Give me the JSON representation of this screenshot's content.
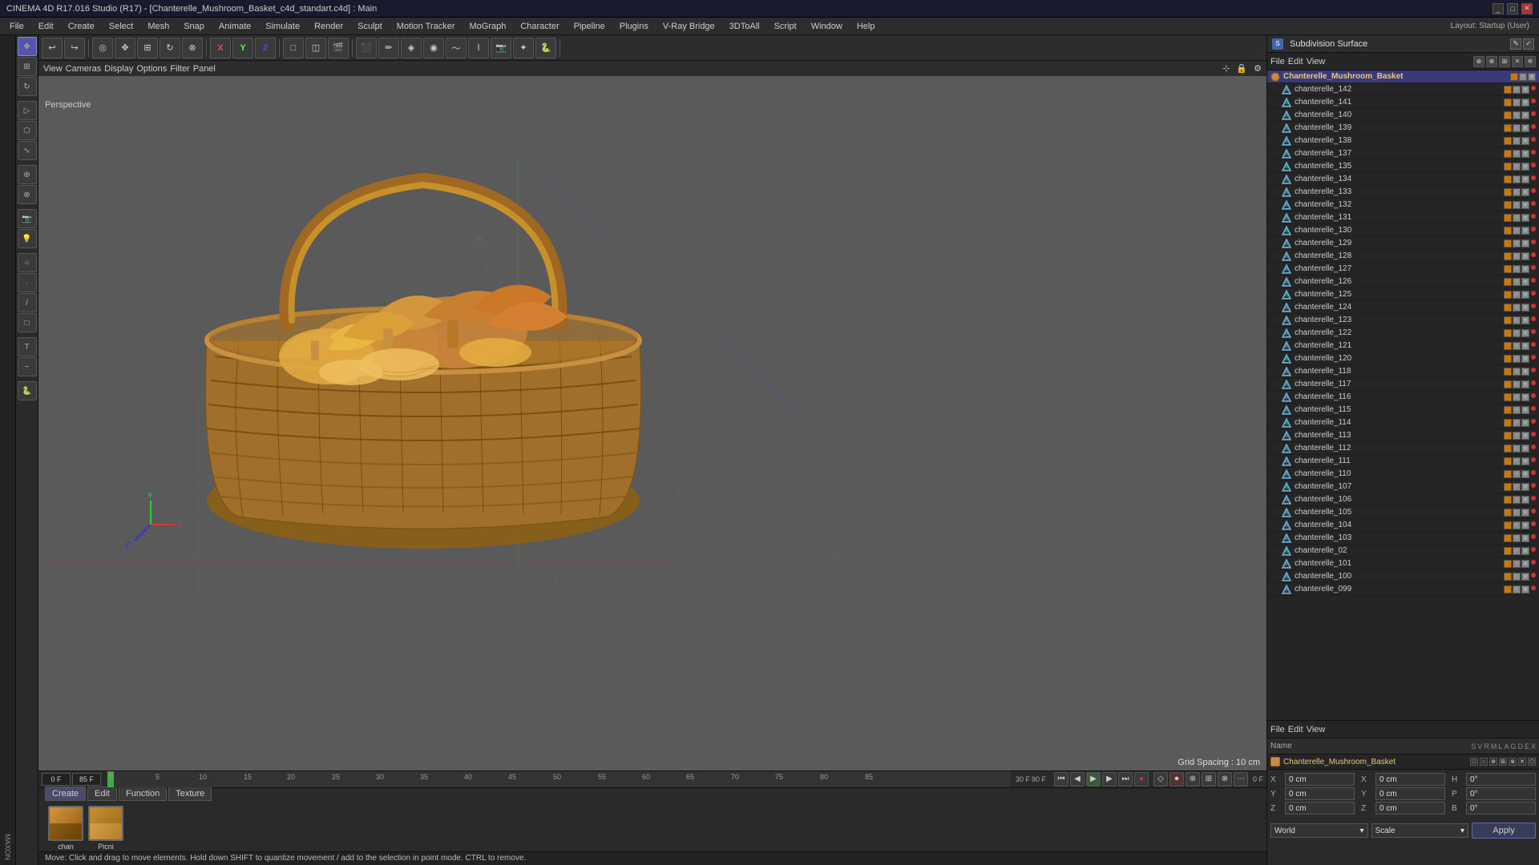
{
  "titleBar": {
    "title": "CINEMA 4D R17.016 Studio (R17) - [Chanterelle_Mushroom_Basket_c4d_standart.c4d] : Main",
    "winControls": [
      "_",
      "□",
      "✕"
    ]
  },
  "menuBar": {
    "items": [
      "File",
      "Edit",
      "Create",
      "Select",
      "Mesh",
      "Snap",
      "Animate",
      "Simulate",
      "Render",
      "Sculpt",
      "Motion Tracker",
      "MoGraph",
      "Character",
      "Pipeline",
      "Plugins",
      "V-Ray Bridge",
      "3DToAll",
      "Script",
      "Window",
      "Help"
    ]
  },
  "topToolbar": {
    "undoLabel": "↩",
    "layoutLabel": "Layout: Startup (User)"
  },
  "viewport": {
    "tabs": [
      "View",
      "Cameras",
      "Display",
      "Options",
      "Filter",
      "Panel"
    ],
    "mode": "Perspective",
    "gridSpacing": "Grid Spacing : 10 cm"
  },
  "timeline": {
    "startFrame": "0 F",
    "endFrame": "90 F",
    "currentFrame": "0 F",
    "fps": "30 F",
    "frameMarkers": [
      0,
      5,
      10,
      15,
      20,
      25,
      30,
      35,
      40,
      45,
      50,
      55,
      60,
      65,
      70,
      75,
      80,
      85
    ],
    "frameEnd": "85 F",
    "playControls": [
      "⏮",
      "⏪",
      "▶",
      "⏩",
      "⏭"
    ]
  },
  "materialTabs": {
    "tabs": [
      "Create",
      "Edit",
      "Function",
      "Texture"
    ],
    "materials": [
      {
        "name": "chan",
        "color1": "#b8860b",
        "color2": "#8b6914"
      },
      {
        "name": "Picni",
        "color1": "#8b6914",
        "color2": "#d4a843"
      }
    ]
  },
  "statusBar": {
    "text": "Move: Click and drag to move elements. Hold down SHIFT to quantize movement / add to the selection in point mode. CTRL to remove."
  },
  "objectManager": {
    "toolbar": [
      "File",
      "Edit",
      "View"
    ],
    "subdivisionSurface": "Subdivision Surface",
    "objects": [
      {
        "name": "Chanterelle_Mushroom_Basket",
        "type": "basket",
        "indent": 0
      },
      {
        "name": "chanterelle_142",
        "type": "mesh",
        "indent": 1
      },
      {
        "name": "chanterelle_141",
        "type": "mesh",
        "indent": 1
      },
      {
        "name": "chanterelle_140",
        "type": "mesh",
        "indent": 1
      },
      {
        "name": "chanterelle_139",
        "type": "mesh",
        "indent": 1
      },
      {
        "name": "chanterelle_138",
        "type": "mesh",
        "indent": 1
      },
      {
        "name": "chanterelle_137",
        "type": "mesh",
        "indent": 1
      },
      {
        "name": "chanterelle_135",
        "type": "mesh",
        "indent": 1
      },
      {
        "name": "chanterelle_134",
        "type": "mesh",
        "indent": 1
      },
      {
        "name": "chanterelle_133",
        "type": "mesh",
        "indent": 1
      },
      {
        "name": "chanterelle_132",
        "type": "mesh",
        "indent": 1
      },
      {
        "name": "chanterelle_131",
        "type": "mesh",
        "indent": 1
      },
      {
        "name": "chanterelle_130",
        "type": "mesh",
        "indent": 1
      },
      {
        "name": "chanterelle_129",
        "type": "mesh",
        "indent": 1
      },
      {
        "name": "chanterelle_128",
        "type": "mesh",
        "indent": 1
      },
      {
        "name": "chanterelle_127",
        "type": "mesh",
        "indent": 1
      },
      {
        "name": "chanterelle_126",
        "type": "mesh",
        "indent": 1
      },
      {
        "name": "chanterelle_125",
        "type": "mesh",
        "indent": 1
      },
      {
        "name": "chanterelle_124",
        "type": "mesh",
        "indent": 1
      },
      {
        "name": "chanterelle_123",
        "type": "mesh",
        "indent": 1
      },
      {
        "name": "chanterelle_122",
        "type": "mesh",
        "indent": 1
      },
      {
        "name": "chanterelle_121",
        "type": "mesh",
        "indent": 1
      },
      {
        "name": "chanterelle_120",
        "type": "mesh",
        "indent": 1
      },
      {
        "name": "chanterelle_118",
        "type": "mesh",
        "indent": 1
      },
      {
        "name": "chanterelle_117",
        "type": "mesh",
        "indent": 1
      },
      {
        "name": "chanterelle_116",
        "type": "mesh",
        "indent": 1
      },
      {
        "name": "chanterelle_115",
        "type": "mesh",
        "indent": 1
      },
      {
        "name": "chanterelle_114",
        "type": "mesh",
        "indent": 1
      },
      {
        "name": "chanterelle_113",
        "type": "mesh",
        "indent": 1
      },
      {
        "name": "chanterelle_112",
        "type": "mesh",
        "indent": 1
      },
      {
        "name": "chanterelle_111",
        "type": "mesh",
        "indent": 1
      },
      {
        "name": "chanterelle_110",
        "type": "mesh",
        "indent": 1
      },
      {
        "name": "chanterelle_107",
        "type": "mesh",
        "indent": 1
      },
      {
        "name": "chanterelle_106",
        "type": "mesh",
        "indent": 1
      },
      {
        "name": "chanterelle_105",
        "type": "mesh",
        "indent": 1
      },
      {
        "name": "chanterelle_104",
        "type": "mesh",
        "indent": 1
      },
      {
        "name": "chanterelle_103",
        "type": "mesh",
        "indent": 1
      },
      {
        "name": "chanterelle_02",
        "type": "mesh",
        "indent": 1
      },
      {
        "name": "chanterelle_101",
        "type": "mesh",
        "indent": 1
      },
      {
        "name": "chanterelle_100",
        "type": "mesh",
        "indent": 1
      },
      {
        "name": "chanterelle_099",
        "type": "mesh",
        "indent": 1
      }
    ]
  },
  "attributeManager": {
    "toolbar": [
      "File",
      "Edit",
      "View"
    ],
    "columns": [
      "Name",
      "S",
      "V",
      "R",
      "M",
      "L",
      "A",
      "G",
      "D",
      "E",
      "X"
    ],
    "objectName": "Chanterelle_Mushroom_Basket",
    "coords": {
      "x": "0 cm",
      "y": "0 cm",
      "z": "0 cm",
      "sx": "0 cm",
      "sy": "0 cm",
      "sz": "0 cm",
      "px": "0°",
      "py": "0°",
      "pz": "0°"
    },
    "transformMode": "World",
    "scaleMode": "Scale",
    "applyBtn": "Apply"
  },
  "icons": {
    "undo": "↩",
    "redo": "↪",
    "move": "✥",
    "scale": "⊞",
    "rotate": "↻",
    "select": "▷",
    "polygon": "⬡",
    "brush": "🖌",
    "playback": {
      "start": "⏮",
      "prev": "◀◀",
      "play": "▶",
      "next": "▶▶",
      "end": "⏭"
    },
    "person": "👤"
  }
}
